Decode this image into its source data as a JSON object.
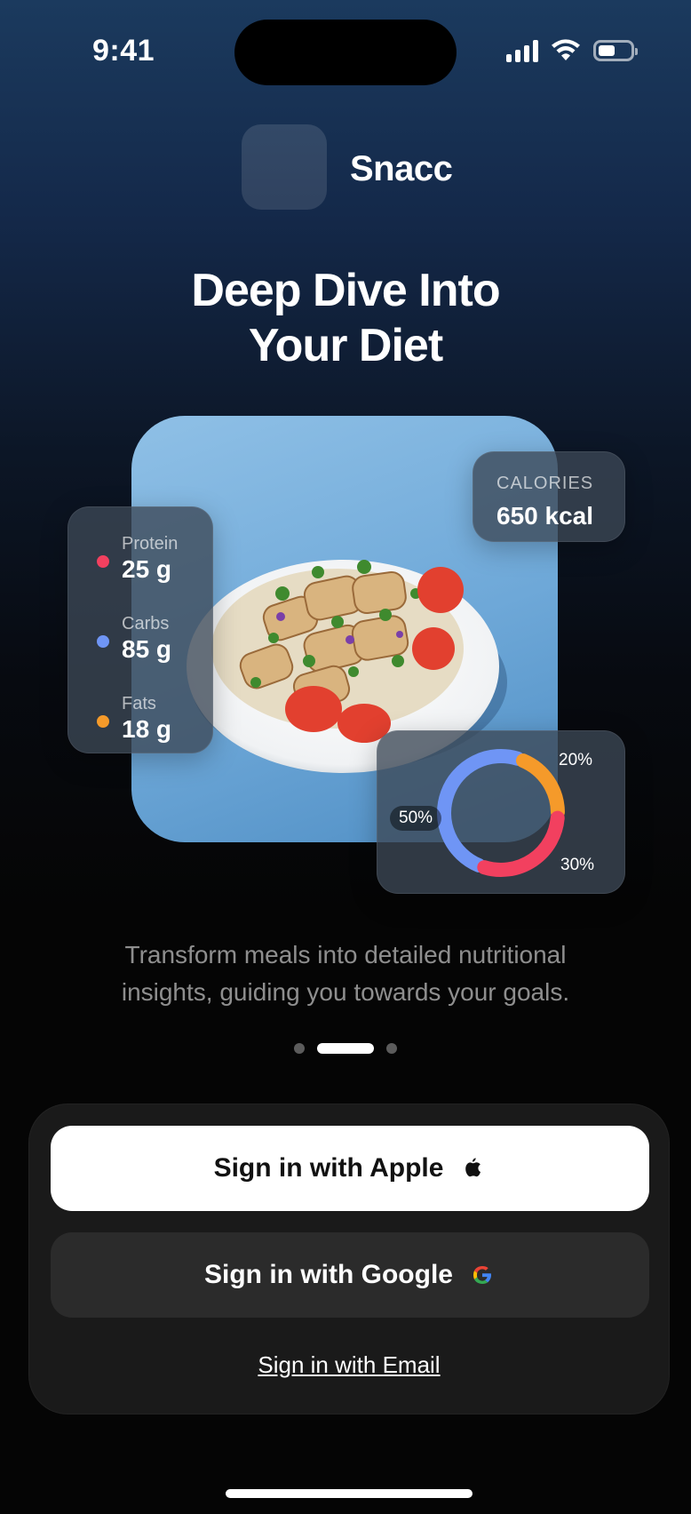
{
  "status_bar": {
    "time": "9:41",
    "icons": [
      "signal-icon",
      "wifi-icon",
      "battery-icon"
    ]
  },
  "brand": {
    "app_name": "Snacc"
  },
  "headline": {
    "line1": "Deep Dive Into",
    "line2": "Your Diet"
  },
  "calories": {
    "label": "CALORIES",
    "value": "650 kcal"
  },
  "macros": [
    {
      "name": "Protein",
      "value": "25 g",
      "color": "#f2405f"
    },
    {
      "name": "Carbs",
      "value": "85 g",
      "color": "#6f95f5"
    },
    {
      "name": "Fats",
      "value": "18 g",
      "color": "#f59a2a"
    }
  ],
  "macro_ring": {
    "segments": [
      {
        "label": "50%",
        "percent": 50,
        "color": "#6f95f5"
      },
      {
        "label": "20%",
        "percent": 20,
        "color": "#f59a2a"
      },
      {
        "label": "30%",
        "percent": 30,
        "color": "#f2405f"
      }
    ]
  },
  "description": {
    "line1": "Transform meals into detailed nutritional",
    "line2": "insights, guiding you towards your goals."
  },
  "pager": {
    "count": 3,
    "active_index": 1
  },
  "auth": {
    "apple_label": "Sign in with Apple",
    "google_label": "Sign in with Google",
    "email_label": "Sign in with Email"
  },
  "colors": {
    "background_top": "#1b3a5e",
    "background_bottom": "#050505",
    "sheet": "#1a1a1a",
    "google_button": "#2b2b2b",
    "apple_button": "#ffffff"
  }
}
